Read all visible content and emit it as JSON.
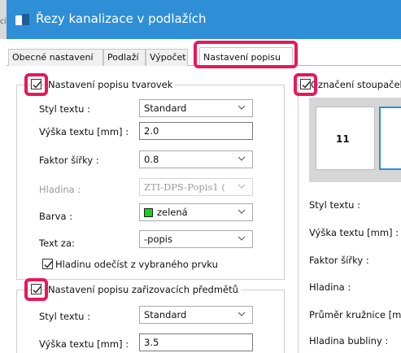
{
  "window": {
    "title": "Řezy kanalizace v podlažích",
    "left_edge_fragment": "cí"
  },
  "tabs": [
    {
      "label": "Obecné nastavení"
    },
    {
      "label": "Podlaží"
    },
    {
      "label": "Výpočet"
    },
    {
      "label": "Nastavení popisu",
      "active": true
    }
  ],
  "group_tvarovky": {
    "checked": true,
    "title": "Nastavení popisu tvarovek",
    "rows": {
      "styl_textu": {
        "label": "Styl textu :",
        "value": "Standard"
      },
      "vyska_textu": {
        "label": "Výška textu [mm] :",
        "value": "2.0"
      },
      "faktor_sirky": {
        "label": "Faktor šířky :",
        "value": "0.8"
      },
      "hladina": {
        "label": "Hladina :",
        "value": "ZTI-DPS-Popis1  ("
      },
      "barva": {
        "label": "Barva :",
        "value": "zelená",
        "color": "#19d019"
      },
      "text_za": {
        "label": "Text za:",
        "value": "-popis"
      }
    },
    "hladinu_checkbox": {
      "checked": true,
      "label": "Hladinu odečíst z vybraného prvku"
    }
  },
  "group_predmety": {
    "checked": true,
    "title": "Nastavení popisu zařizovacích předmětů",
    "rows": {
      "styl_textu": {
        "label": "Styl textu :",
        "value": "Standard"
      },
      "vyska_textu": {
        "label": "Výška textu [mm] :",
        "value": "3.5"
      }
    }
  },
  "group_stoupacky": {
    "checked": true,
    "title": "Označení stoupaček",
    "preview_number": "11",
    "labels": {
      "styl_textu": "Styl textu :",
      "vyska_textu": "Výška textu [mm] :",
      "faktor_sirky": "Faktor šířky :",
      "hladina": "Hladina :",
      "prumer_kruznice": "Průměr kružnice [mm] :",
      "hladina_bubliny": "Hladina bubliny :"
    }
  },
  "colors": {
    "highlight": "#e8185a",
    "titlebar": "#2f8fd6"
  }
}
